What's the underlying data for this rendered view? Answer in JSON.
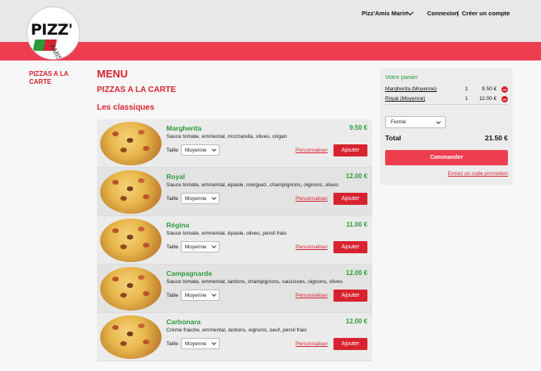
{
  "header": {
    "logo_text": "PIZZ'",
    "logo_sub": "AMIS",
    "site_name": "Pizz'Amis Marin",
    "login": "Connexion",
    "separator": "|",
    "register": "Créer un compte"
  },
  "sidebar": {
    "items": [
      {
        "label": "PIZZAS A LA CARTE"
      }
    ]
  },
  "main": {
    "title": "MENU",
    "section": "PIZZAS A LA CARTE",
    "subsection": "Les classiques",
    "size_label": "Taille",
    "customize_label": "Personnaliser",
    "add_label": "Ajouter",
    "products": [
      {
        "name": "Margherita",
        "price": "9.50 €",
        "description": "Sauce tomate, emmental, mozzarella, olives, origan",
        "size": "Moyenne"
      },
      {
        "name": "Royal",
        "price": "12.00 €",
        "description": "Sauce tomate, emmental, épaule, merguez, champignons, oignons, olives",
        "size": "Moyenne"
      },
      {
        "name": "Régina",
        "price": "11.00 €",
        "description": "Sauce tomate, emmental, épaule, olives, persil frais",
        "size": "Moyenne"
      },
      {
        "name": "Campagnarde",
        "price": "12.00 €",
        "description": "Sauce tomate, emmental, lardons, champignons, saucisses, oignons, olives",
        "size": "Moyenne"
      },
      {
        "name": "Carbonara",
        "price": "12.00 €",
        "description": "Crème fraiche, emmental, lardons, oignons, oeuf, persil frais",
        "size": "Moyenne"
      }
    ]
  },
  "cart": {
    "title": "Votre panier",
    "items": [
      {
        "name": "Margherita (Moyenne)",
        "qty": "1",
        "price": "9.50 €"
      },
      {
        "name": "Royal (Moyenne)",
        "qty": "1",
        "price": "12.00 €"
      }
    ],
    "status": "Fermé",
    "total_label": "Total",
    "total_value": "21.50 €",
    "order_button": "Commander",
    "promo_link": "Entrez un code promotion"
  },
  "colors": {
    "brand_red": "#d8232f",
    "band_red": "#ee3d4f",
    "price_green": "#2c9a3a"
  }
}
